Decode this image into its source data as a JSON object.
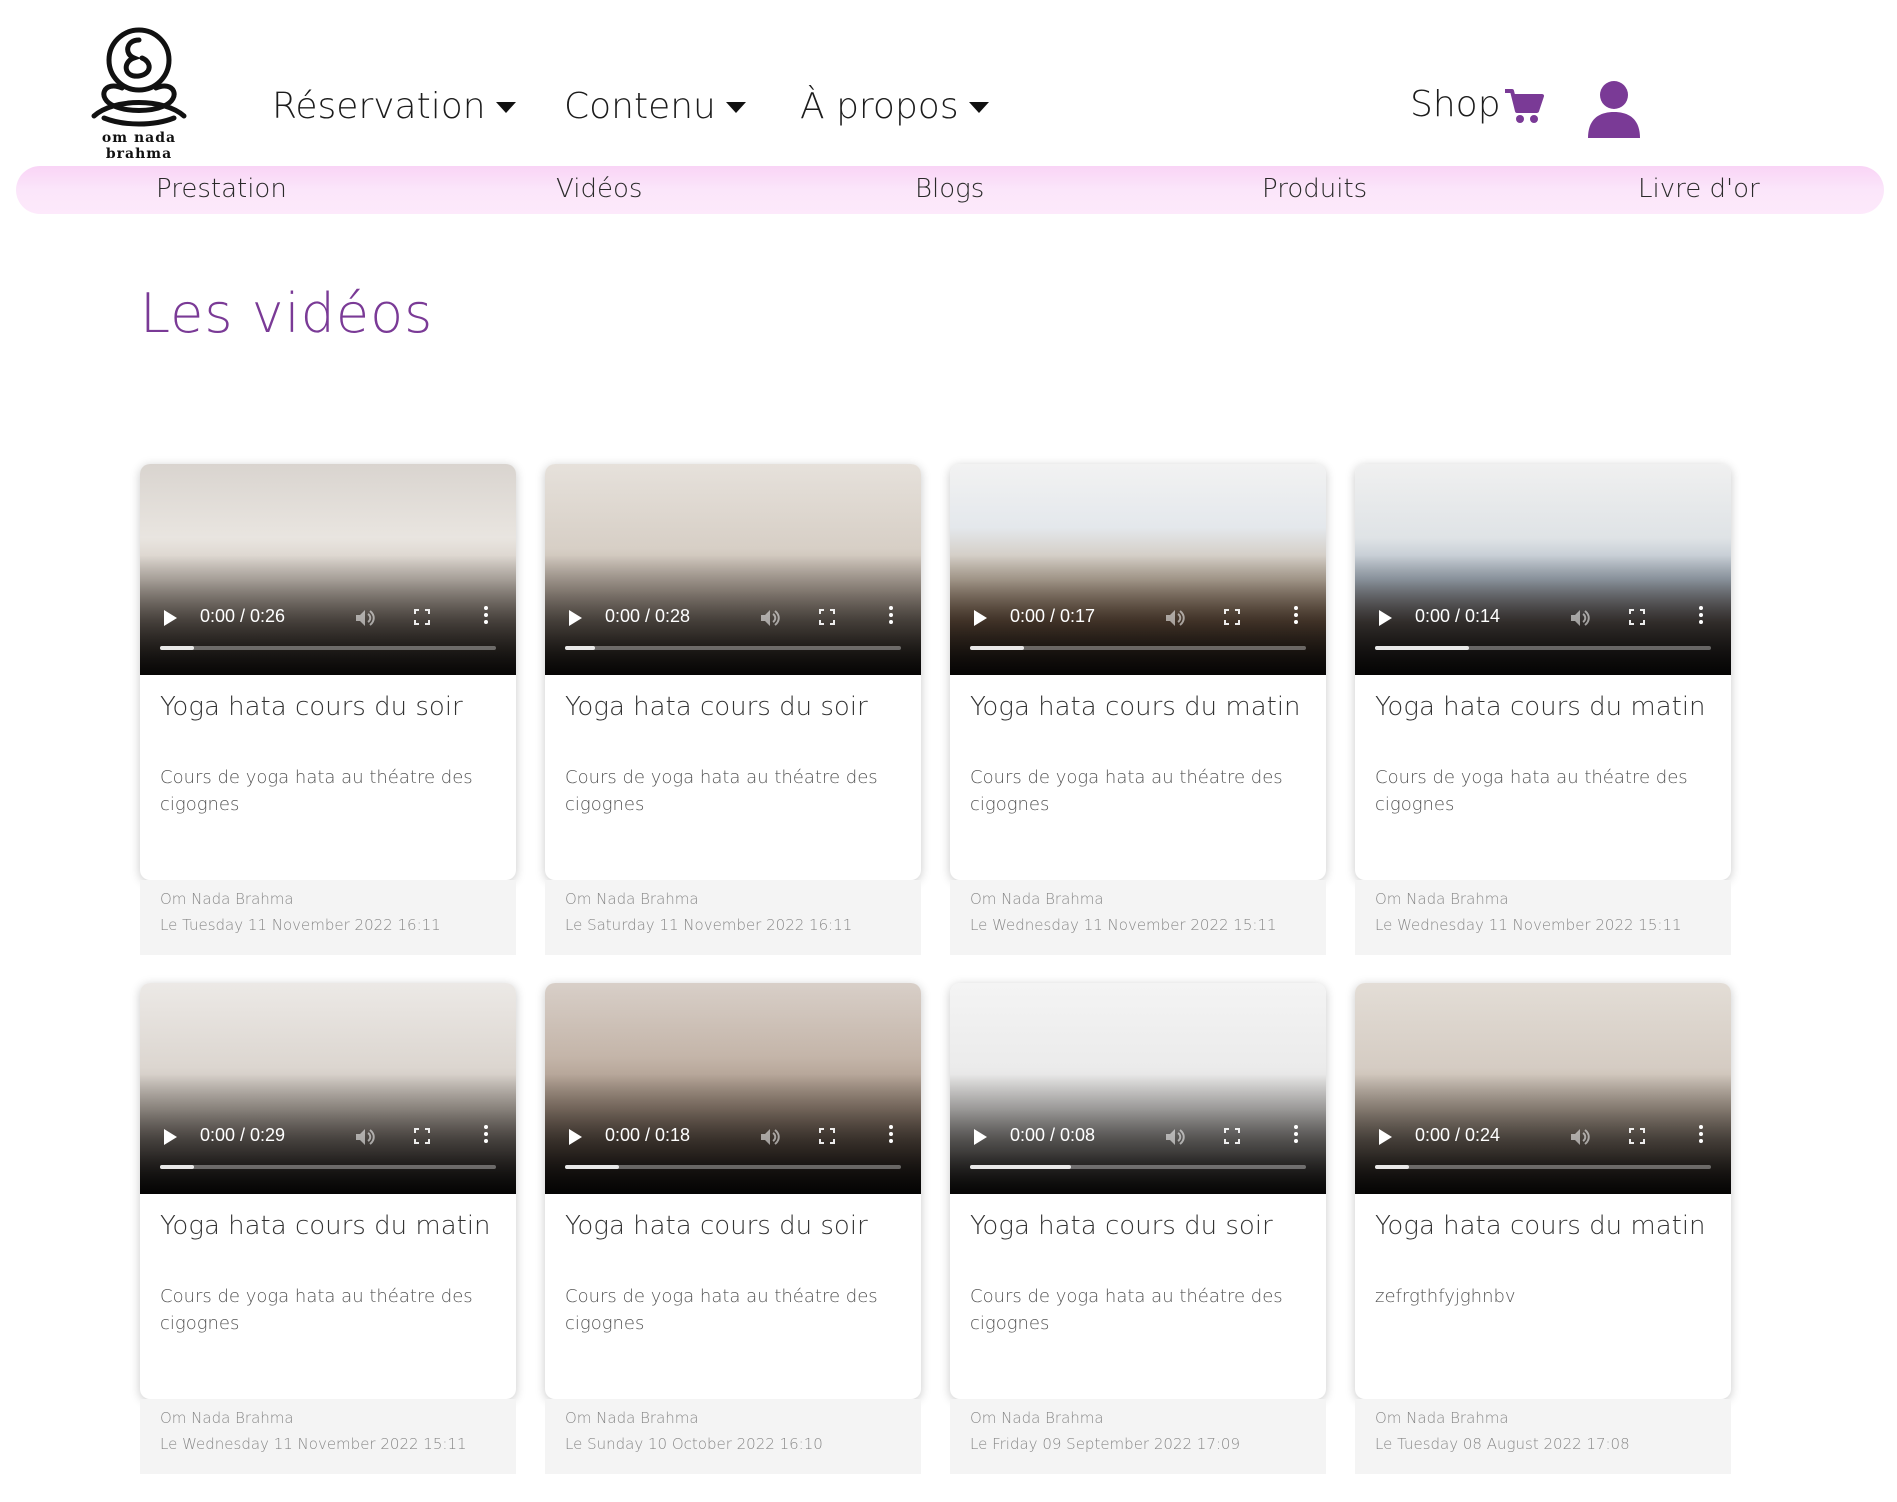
{
  "brand": {
    "logo_text": "om nada brahma"
  },
  "nav": {
    "items": [
      {
        "label": "Réservation"
      },
      {
        "label": "Contenu"
      },
      {
        "label": "À propos"
      }
    ],
    "shop_label": "Shop"
  },
  "subnav": {
    "items": [
      {
        "label": "Prestation"
      },
      {
        "label": "Vidéos"
      },
      {
        "label": "Blogs"
      },
      {
        "label": "Produits"
      },
      {
        "label": "Livre d'or"
      }
    ]
  },
  "page": {
    "title": "Les vidéos"
  },
  "colors": {
    "accent": "#7a3a96",
    "subnav_pink": "#fbe3fa"
  },
  "videos": [
    {
      "title": "Yoga hata cours du soir",
      "description": "Cours de yoga hata au théatre des cigognes",
      "author": "Om Nada Brahma",
      "date": "Le Tuesday 11 November 2022 16:11",
      "time": "0:00 / 0:26",
      "progress": 0.1
    },
    {
      "title": "Yoga hata cours du soir",
      "description": "Cours de yoga hata au théatre des cigognes",
      "author": "Om Nada Brahma",
      "date": "Le Saturday 11 November 2022 16:11",
      "time": "0:00 / 0:28",
      "progress": 0.09
    },
    {
      "title": "Yoga hata cours du matin",
      "description": "Cours de yoga hata au théatre des cigognes",
      "author": "Om Nada Brahma",
      "date": "Le Wednesday 11 November 2022 15:11",
      "time": "0:00 / 0:17",
      "progress": 0.16
    },
    {
      "title": "Yoga hata cours du matin",
      "description": "Cours de yoga hata au théatre des cigognes",
      "author": "Om Nada Brahma",
      "date": "Le Wednesday 11 November 2022 15:11",
      "time": "0:00 / 0:14",
      "progress": 0.28
    },
    {
      "title": "Yoga hata cours du matin",
      "description": "Cours de yoga hata au théatre des cigognes",
      "author": "Om Nada Brahma",
      "date": "Le Wednesday 11 November 2022 15:11",
      "time": "0:00 / 0:29",
      "progress": 0.1
    },
    {
      "title": "Yoga hata cours du soir",
      "description": "Cours de yoga hata au théatre des cigognes",
      "author": "Om Nada Brahma",
      "date": "Le Sunday 10 October 2022 16:10",
      "time": "0:00 / 0:18",
      "progress": 0.16
    },
    {
      "title": "Yoga hata cours du soir",
      "description": "Cours de yoga hata au théatre des cigognes",
      "author": "Om Nada Brahma",
      "date": "Le Friday 09 September 2022 17:09",
      "time": "0:00 / 0:08",
      "progress": 0.3
    },
    {
      "title": "Yoga hata cours du matin",
      "description": "zefrgthfyjghnbv",
      "author": "Om Nada Brahma",
      "date": "Le Tuesday 08 August 2022 17:08",
      "time": "0:00 / 0:24",
      "progress": 0.1
    }
  ]
}
